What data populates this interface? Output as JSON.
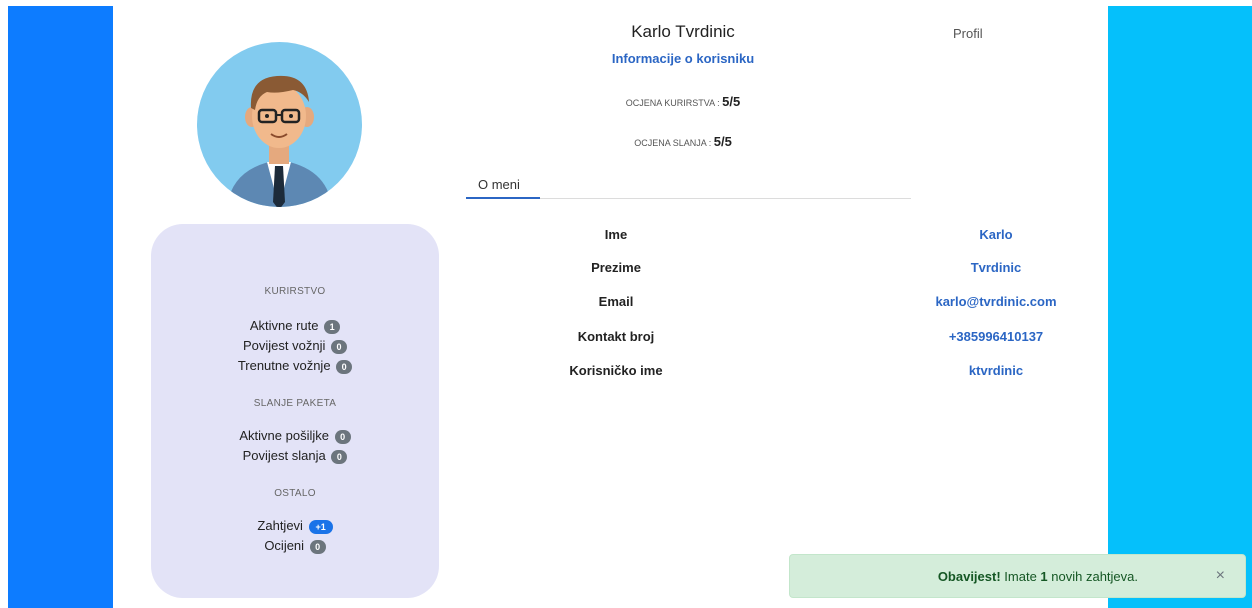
{
  "user": {
    "full_name": "Karlo Tvrdinic",
    "info_link": "Informacije o korisniku"
  },
  "header": {
    "profile_label": "Profil"
  },
  "ratings": {
    "courier_label": "OCJENA KURIRSTVA :",
    "courier_value": "5/5",
    "sending_label": "OCJENA SLANJA :",
    "sending_value": "5/5"
  },
  "tabs": [
    {
      "label": "O meni"
    }
  ],
  "sidebar": {
    "sections": [
      {
        "title": "KURIRSTVO",
        "items": [
          {
            "label": "Aktivne rute",
            "count": "1"
          },
          {
            "label": "Povijest vožnji",
            "count": "0"
          },
          {
            "label": "Trenutne vožnje",
            "count": "0"
          }
        ]
      },
      {
        "title": "SLANJE PAKETA",
        "items": [
          {
            "label": "Aktivne pošiljke",
            "count": "0"
          },
          {
            "label": "Povijest slanja",
            "count": "0"
          }
        ]
      },
      {
        "title": "OSTALO",
        "items": [
          {
            "label": "Zahtjevi",
            "count": "+1"
          },
          {
            "label": "Ocijeni",
            "count": "0"
          }
        ]
      }
    ]
  },
  "details": [
    {
      "label": "Ime",
      "value": "Karlo"
    },
    {
      "label": "Prezime",
      "value": "Tvrdinic"
    },
    {
      "label": "Email",
      "value": "karlo@tvrdinic.com"
    },
    {
      "label": "Kontakt broj",
      "value": "+385996410137"
    },
    {
      "label": "Korisničko ime",
      "value": "ktvrdinic"
    }
  ],
  "toast": {
    "strong": "Obavijest!",
    "before": " Imate ",
    "count": "1",
    "after": " novih zahtjeva.",
    "close": "×"
  },
  "colors": {
    "left_band": "#0d7cff",
    "right_band": "#05c0fb",
    "accent": "#2b66c4",
    "sidebar_bg": "#e3e3f7",
    "toast_bg": "#d4edda"
  }
}
